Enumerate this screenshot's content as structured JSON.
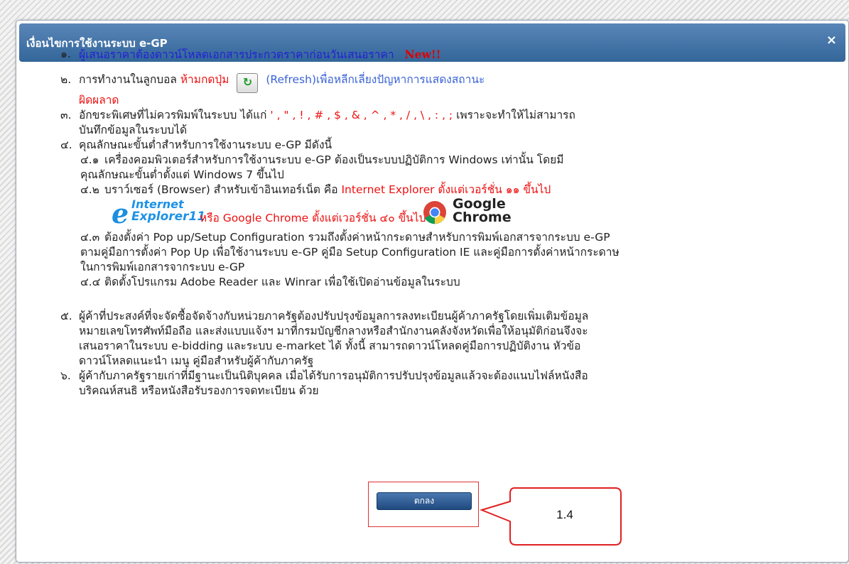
{
  "dialog": {
    "title": "เงื่อนไขการใช้งานระบบ e-GP",
    "close_symbol": "×"
  },
  "items": [
    {
      "num": "๑.",
      "text": "ผู้เสนอราคาต้องดาวน์โหลดเอกสารประกวดราคาก่อนวันเสนอราคา",
      "badge": "New!!"
    },
    {
      "num": "๒.",
      "text_a": "การทำงานในลูกบอล",
      "text_red": "ห้ามกดปุ่ม",
      "refresh_icon": "refresh-icon",
      "text_link": "(Refresh)เพื่อหลีกเลี่ยงปัญหาการแสดงสถานะ",
      "text_red2": "ผิดผลาด"
    },
    {
      "num": "๓.",
      "text_a": "อักขระพิเศษที่ไม่ควรพิมพ์ในระบบ ได้แก่",
      "chars": "' , \" , ! , # , $ , & , ^ , * , / , \\ , : , ;",
      "text_b": "เพราะจะทำให้ไม่สามารถ",
      "text_c": "บันทึกข้อมูลในระบบได้"
    },
    {
      "num": "๔.",
      "text": "คุณลักษณะขั้นต่ำสำหรับการใช้งานระบบ e-GP มีดังนี้",
      "subs": [
        {
          "num": "๔.๑",
          "line1": "เครื่องคอมพิวเตอร์สำหรับการใช้งานระบบ e-GP ต้องเป็นระบบปฏิบัติการ Windows เท่านั้น โดยมี",
          "line2": "คุณลักษณะขั้นต่ำตั้งแต่ Windows 7 ขึ้นไป"
        },
        {
          "num": "๔.๒",
          "text_a": "บราว์เซอร์ (Browser) สำหรับเข้าอินเทอร์เน็ต คือ",
          "text_red": "Internet Explorer ตั้งแต่เวอร์ชั่น ๑๑ ขึ้นไป",
          "ie_logo_1": "Internet",
          "ie_logo_2": "Explorer11",
          "chrome_text": "หรือ Google Chrome ตั้งแต่เวอร์ชั่น ๔๐ ขึ้นไป",
          "chrome_logo_1": "Google",
          "chrome_logo_2": "Chrome"
        },
        {
          "num": "๔.๓",
          "line1": "ต้องตั้งค่า Pop up/Setup Configuration รวมถึงตั้งค่าหน้ากระดาษสำหรับการพิมพ์เอกสารจากระบบ e-GP",
          "line2": "ตามคู่มือการตั้งค่า Pop Up เพื่อใช้งานระบบ e-GP คู่มือ Setup Configuration IE และคู่มือการตั้งค่าหน้ากระดาษ",
          "line3": "ในการพิมพ์เอกสารจากระบบ e-GP"
        },
        {
          "num": "๔.๔",
          "line1": "ติดตั้งโปรแกรม Adobe Reader และ Winrar เพื่อใช้เปิดอ่านข้อมูลในระบบ"
        }
      ]
    },
    {
      "num": "๕.",
      "line1": "ผู้ค้าที่ประสงค์ที่จะจัดซื้อจัดจ้างกับหน่วยภาครัฐต้องปรับปรุงข้อมูลการลงทะเบียนผู้ค้าภาครัฐโดยเพิ่มเติมข้อมูล",
      "line2": "หมายเลขโทรศัพท์มือถือ และส่งแบบแจ้งฯ มาที่กรมบัญชีกลางหรือสำนักงานคลังจังหวัดเพื่อให้อนุมัติก่อนจึงจะ",
      "line3": "เสนอราคาในระบบ e-bidding และระบบ e-market ได้ ทั้งนี้ สามารถดาวน์โหลดคู่มือการปฏิบัติงาน หัวข้อ",
      "line4": "ดาวน์โหลดแนะนำ เมนู คู่มือสำหรับผู้ค้ากับภาครัฐ"
    },
    {
      "num": "๖.",
      "line1": "ผู้ค้ากับภาครัฐรายเก่าที่มีฐานะเป็นนิติบุคคล เมื่อได้รับการอนุมัติการปรับปรุงข้อมูลแล้วจะต้องแนบไฟล์หนังสือ",
      "line2": "บริคณห์สนธิ หรือหนังสือรับรองการจดทะเบียน ด้วย"
    }
  ],
  "ok_button": {
    "label": "ตกลง"
  },
  "callout": {
    "label": "1.4"
  },
  "colors": {
    "title_bar": "#336699",
    "red_text": "#ee1111",
    "blue_text": "#2222d4",
    "link_blue": "#3a62d6",
    "highlight_border": "#e03030"
  }
}
